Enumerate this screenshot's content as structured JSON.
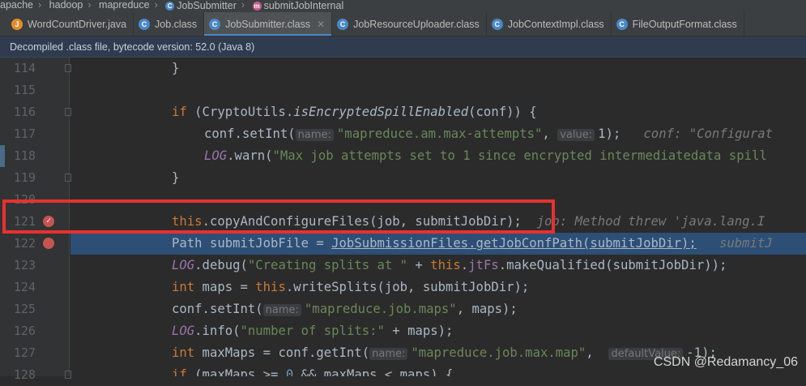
{
  "breadcrumb": [
    {
      "label": "apache",
      "icon": ""
    },
    {
      "label": "hadoop",
      "icon": ""
    },
    {
      "label": "mapreduce",
      "icon": ""
    },
    {
      "label": "JobSubmitter",
      "icon": "class-icon",
      "color": "#4a88c7"
    },
    {
      "label": "submitJobInternal",
      "icon": "method-icon",
      "color": "#c75e8f"
    }
  ],
  "tabs": [
    {
      "label": "WordCountDriver.java",
      "icon": "java-file-icon",
      "active": false
    },
    {
      "label": "Job.class",
      "icon": "class-icon",
      "active": false
    },
    {
      "label": "JobSubmitter.class",
      "icon": "class-icon",
      "active": true
    },
    {
      "label": "JobResourceUploader.class",
      "icon": "class-icon",
      "active": false
    },
    {
      "label": "JobContextImpl.class",
      "icon": "class-icon",
      "active": false
    },
    {
      "label": "FileOutputFormat.class",
      "icon": "class-icon",
      "active": false
    }
  ],
  "notice": {
    "text": "Decompiled .class file, bytecode version: 52.0 (Java 8)"
  },
  "gutter": {
    "line_numbers": [
      "114",
      "115",
      "116",
      "117",
      "118",
      "119",
      "120",
      "121",
      "122",
      "123",
      "124",
      "125",
      "126",
      "127",
      "128"
    ]
  },
  "code": {
    "l114": "}",
    "l116_kw": "if",
    "l116_a": " (CryptoUtils.",
    "l116_m": "isEncryptedSpillEnabled",
    "l116_b": "(conf)) {",
    "l117_a": "conf.setInt(",
    "l117_h1": "name:",
    "l117_s": "\"mapreduce.am.max-attempts\"",
    "l117_c": ", ",
    "l117_h2": "value:",
    "l117_v": "1);",
    "l117_inline": "conf: \"Configurat",
    "l118_f": "LOG",
    "l118_a": ".warn(",
    "l118_s": "\"Max job attempts set to 1 since encrypted intermediatedata spill",
    "l119": "}",
    "l121_kw": "this",
    "l121_a": ".copyAndConfigureFiles(job, submitJobDir);",
    "l121_inline": "job: Method threw 'java.lang.I",
    "l122_a": "Path submitJobFile = ",
    "l122_link": "JobSubmissionFiles.getJobConfPath(submitJobDir);",
    "l122_inline": "submitJ",
    "l123_f": "LOG",
    "l123_a": ".debug(",
    "l123_s": "\"Creating splits at \"",
    "l123_b": " + ",
    "l123_kw": "this",
    "l123_c": ".",
    "l123_f2": "jtFs",
    "l123_d": ".makeQualified(submitJobDir));",
    "l124_kw": "int",
    "l124_a": " maps = ",
    "l124_kw2": "this",
    "l124_b": ".writeSplits(job, submitJobDir);",
    "l125_a": "conf.setInt(",
    "l125_h": "name:",
    "l125_s": "\"mapreduce.job.maps\"",
    "l125_b": ", maps);",
    "l126_f": "LOG",
    "l126_a": ".info(",
    "l126_s": "\"number of splits:\"",
    "l126_b": " + maps);",
    "l127_kw": "int",
    "l127_a": " maxMaps = conf.getInt(",
    "l127_h": "name:",
    "l127_s": "\"mapreduce.job.max.map\"",
    "l127_c": ",  ",
    "l127_h2": "defaultValue:",
    "l127_v": "-1);",
    "l128_kw": "if",
    "l128_a": " (maxMaps >= ",
    "l128_n": "0",
    "l128_b": " && maxMaps < maps) {"
  },
  "watermark": "CSDN @Redamancy_06",
  "colors": {
    "keyword": "#cc7832",
    "string": "#6a8759",
    "field": "#9876aa",
    "annotation": "#e8312f",
    "current_line": "#2d4f76"
  }
}
